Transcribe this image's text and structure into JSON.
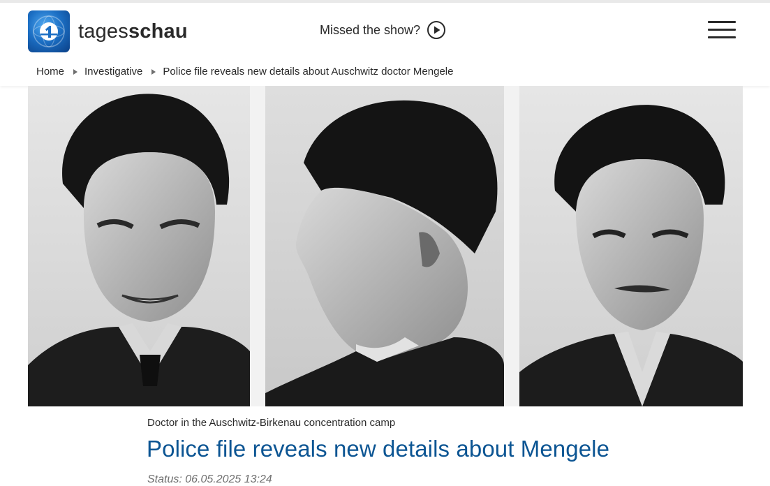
{
  "header": {
    "logo_text_regular": "tages",
    "logo_text_bold": "schau",
    "missed_show_label": "Missed the show?",
    "play_icon": "play-circle-icon",
    "menu_icon": "hamburger-menu-icon"
  },
  "breadcrumb": {
    "items": [
      "Home",
      "Investigative",
      "Police file reveals new details about Auschwitz doctor Mengele"
    ]
  },
  "hero": {
    "description": "Three black-and-white portrait photographs"
  },
  "article": {
    "topline": "Doctor in the Auschwitz-Birkenau concentration camp",
    "headline": "Police file reveals new details about Mengele",
    "status": "Status: 06.05.2025 13:24"
  },
  "colors": {
    "headline": "#0c5593",
    "logo_blue": "#1c6fc4"
  }
}
